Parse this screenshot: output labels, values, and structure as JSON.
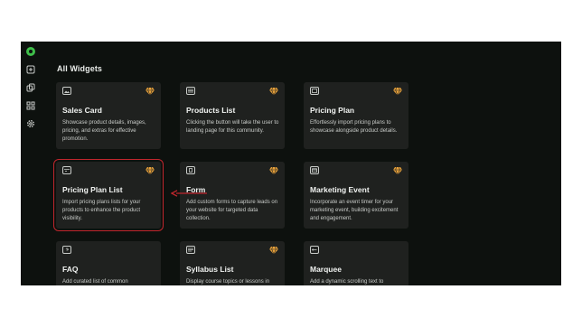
{
  "sidebar": {
    "items": [
      {
        "icon": "add-square-icon"
      },
      {
        "icon": "copy-icon"
      },
      {
        "icon": "grid-icon"
      },
      {
        "icon": "settings-icon"
      }
    ]
  },
  "main": {
    "title": "All Widgets",
    "cards": [
      {
        "title": "Sales Card",
        "desc": "Showcase product details, images, pricing, and extras for effective promotion.",
        "icon": "image-icon",
        "premium_icon": "gem-icon"
      },
      {
        "title": "Products List",
        "desc": "Clicking the button will take the user to landing page for this community.",
        "icon": "list-icon",
        "premium_icon": "gem-icon"
      },
      {
        "title": "Pricing Plan",
        "desc": "Effortlessly import pricing plans to showcase alongside product details.",
        "icon": "window-icon",
        "premium_icon": "gem-icon"
      },
      {
        "title": "Pricing Plan List",
        "desc": "Import pricing plans lists for your products to enhance the product visibility.",
        "icon": "card-icon",
        "premium_icon": "gem-icon"
      },
      {
        "title": "Form",
        "desc": "Add custom forms to capture leads on your website for targeted data collection.",
        "icon": "form-icon",
        "premium_icon": "gem-icon"
      },
      {
        "title": "Marketing Event",
        "desc": "Incorporate an event timer for your marketing event, building excitement and engagement.",
        "icon": "calendar-icon",
        "premium_icon": "gem-icon"
      },
      {
        "title": "FAQ",
        "desc": "Add curated list of common",
        "icon": "faq-icon",
        "premium_icon": ""
      },
      {
        "title": "Syllabus List",
        "desc": "Display course topics or lessons in",
        "icon": "syllabus-icon",
        "premium_icon": "gem-icon"
      },
      {
        "title": "Marquee",
        "desc": "Add a dynamic scrolling text to",
        "icon": "marquee-icon",
        "premium_icon": ""
      }
    ]
  },
  "colors": {
    "app_background": "#0d110e",
    "card_background": "#1f211f",
    "brand_green": "#3fbf4a",
    "premium_gold": "#e9a23b",
    "highlight_red": "#c0262d"
  }
}
